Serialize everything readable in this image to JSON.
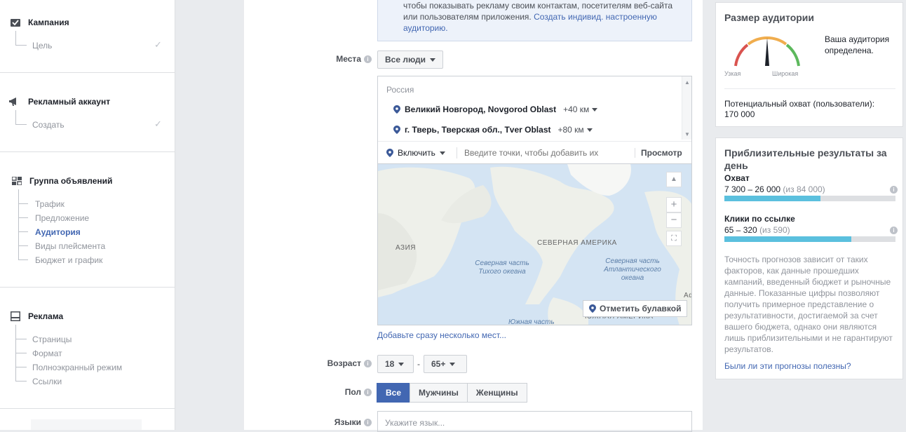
{
  "sidebar": {
    "campaign": {
      "title": "Кампания",
      "items": [
        {
          "label": "Цель"
        }
      ]
    },
    "ad_account": {
      "title": "Рекламный аккаунт",
      "items": [
        {
          "label": "Создать"
        }
      ]
    },
    "ad_set": {
      "title": "Группа объявлений",
      "items": [
        {
          "label": "Трафик"
        },
        {
          "label": "Предложение"
        },
        {
          "label": "Аудитория"
        },
        {
          "label": "Виды плейсмента"
        },
        {
          "label": "Бюджет и график"
        }
      ],
      "active_item": "Аудитория"
    },
    "ad": {
      "title": "Реклама",
      "items": [
        {
          "label": "Страницы"
        },
        {
          "label": "Формат"
        },
        {
          "label": "Полноэкранный режим"
        },
        {
          "label": "Ссылки"
        }
      ]
    }
  },
  "main": {
    "info_text": "чтобы показывать рекламу своим контактам, посетителям веб-сайта или пользователям приложения.",
    "info_link": "Создать индивид. настроенную аудиторию.",
    "locations": {
      "label": "Места",
      "dropdown": "Все люди",
      "country": "Россия",
      "items": [
        {
          "name": "Великий Новгород, Novgorod Oblast",
          "radius": "+40 км"
        },
        {
          "name": "г. Тверь, Тверская обл., Tver Oblast",
          "radius": "+80 км"
        }
      ],
      "include_label": "Включить",
      "search_placeholder": "Введите точки, чтобы добавить их",
      "browse_label": "Просмотр",
      "map": {
        "labels": {
          "asia": "АЗИЯ",
          "north_america": "СЕВЕРНАЯ АМЕРИКА",
          "north_pacific": "Северная часть Тихого океана",
          "north_atlantic": "Северная часть Атлантического океана",
          "south_america": "ЮЖНАЯ АМЕРИКА",
          "south_pacific": "Южная часть",
          "africa": "Аф"
        },
        "drop_pin_label": "Отметить булавкой",
        "zoom_in": "+",
        "zoom_out": "−"
      },
      "bulk_link": "Добавьте сразу несколько мест..."
    },
    "age": {
      "label": "Возраст",
      "min": "18",
      "max": "65+",
      "separator": "-"
    },
    "gender": {
      "label": "Пол",
      "options": [
        "Все",
        "Мужчины",
        "Женщины"
      ],
      "selected": "Все"
    },
    "languages": {
      "label": "Языки",
      "placeholder": "Укажите язык..."
    }
  },
  "audience_size": {
    "title": "Размер аудитории",
    "status": "Ваша аудитория определена.",
    "narrow": "Узкая",
    "broad": "Широкая",
    "reach_label": "Потенциальный охват (пользователи):",
    "reach_value": "170 000"
  },
  "estimates": {
    "title": "Приблизительные результаты за день",
    "reach": {
      "label": "Охват",
      "range": "7 300 – 26 000",
      "of": "(из 84 000)",
      "fill": 0.56
    },
    "clicks": {
      "label": "Клики по ссылке",
      "range": "65 – 320",
      "of": "(из 590)",
      "fill": 0.74
    },
    "disclaimer": "Точность прогнозов зависит от таких факторов, как данные прошедших кампаний, введенный бюджет и рыночные данные. Показанные цифры позволяют получить примерное представление о результативности, достигаемой за счет вашего бюджета, однако они являются лишь приблизительными и не гарантируют результатов.",
    "feedback_link": "Были ли эти прогнозы полезны?"
  },
  "colors": {
    "accent": "#4267b2",
    "bar": "#5bc0de",
    "gauge_red": "#d9534f",
    "gauge_yellow": "#f0ad4e",
    "gauge_green": "#5cb85c"
  }
}
